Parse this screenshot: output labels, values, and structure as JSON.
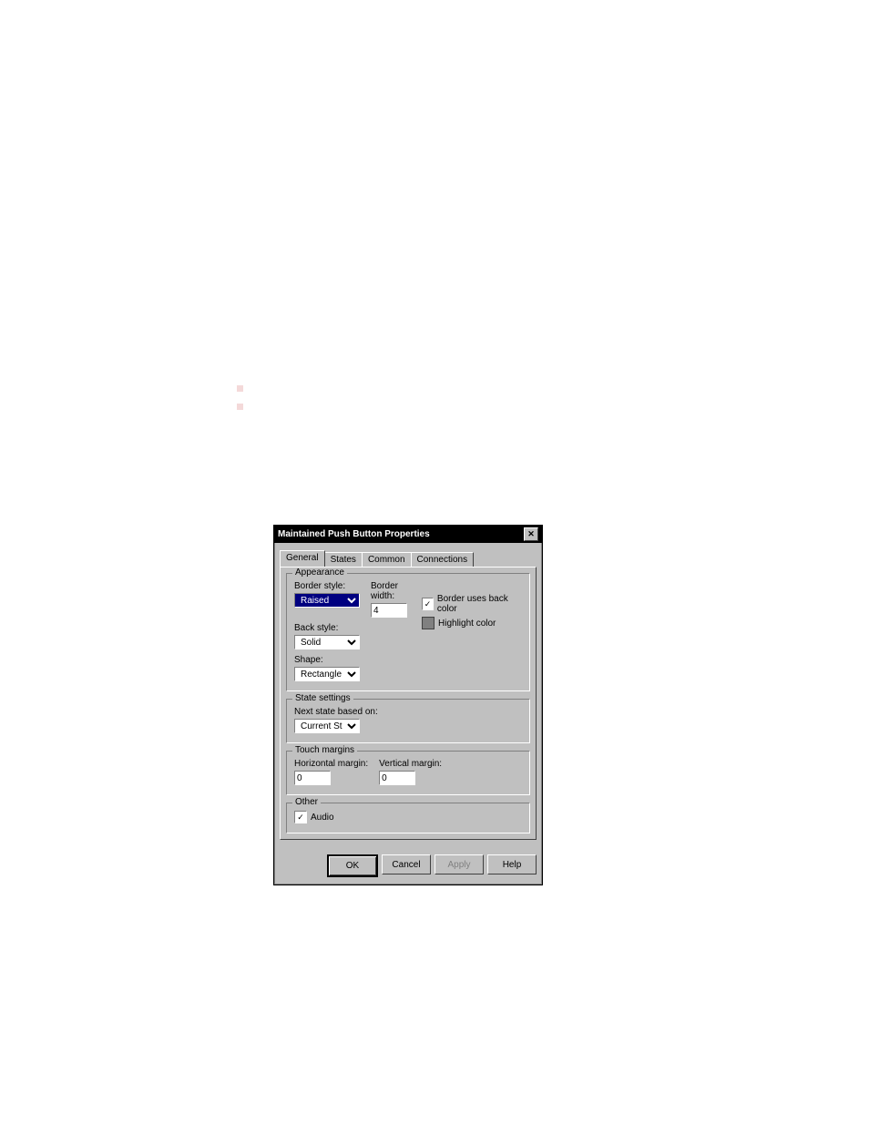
{
  "doc_bullets": [
    "",
    ""
  ],
  "dialog": {
    "title": "Maintained Push Button Properties",
    "tabs": [
      "General",
      "States",
      "Common",
      "Connections"
    ],
    "active_tab": "General",
    "appearance": {
      "group_label": "Appearance",
      "border_style_label": "Border style:",
      "border_style_value": "Raised",
      "border_width_label": "Border width:",
      "border_width_value": "4",
      "back_style_label": "Back style:",
      "back_style_value": "Solid",
      "shape_label": "Shape:",
      "shape_value": "Rectangle",
      "border_uses_back_label": "Border uses back color",
      "border_uses_back_checked": true,
      "highlight_label": "Highlight color"
    },
    "state_settings": {
      "group_label": "State settings",
      "next_state_label": "Next state based on:",
      "next_state_value": "Current State"
    },
    "touch_margins": {
      "group_label": "Touch margins",
      "h_label": "Horizontal  margin:",
      "h_value": "0",
      "v_label": "Vertical margin:",
      "v_value": "0"
    },
    "other": {
      "group_label": "Other",
      "audio_label": "Audio",
      "audio_checked": true
    },
    "buttons": {
      "ok": "OK",
      "cancel": "Cancel",
      "apply": "Apply",
      "help": "Help"
    }
  }
}
